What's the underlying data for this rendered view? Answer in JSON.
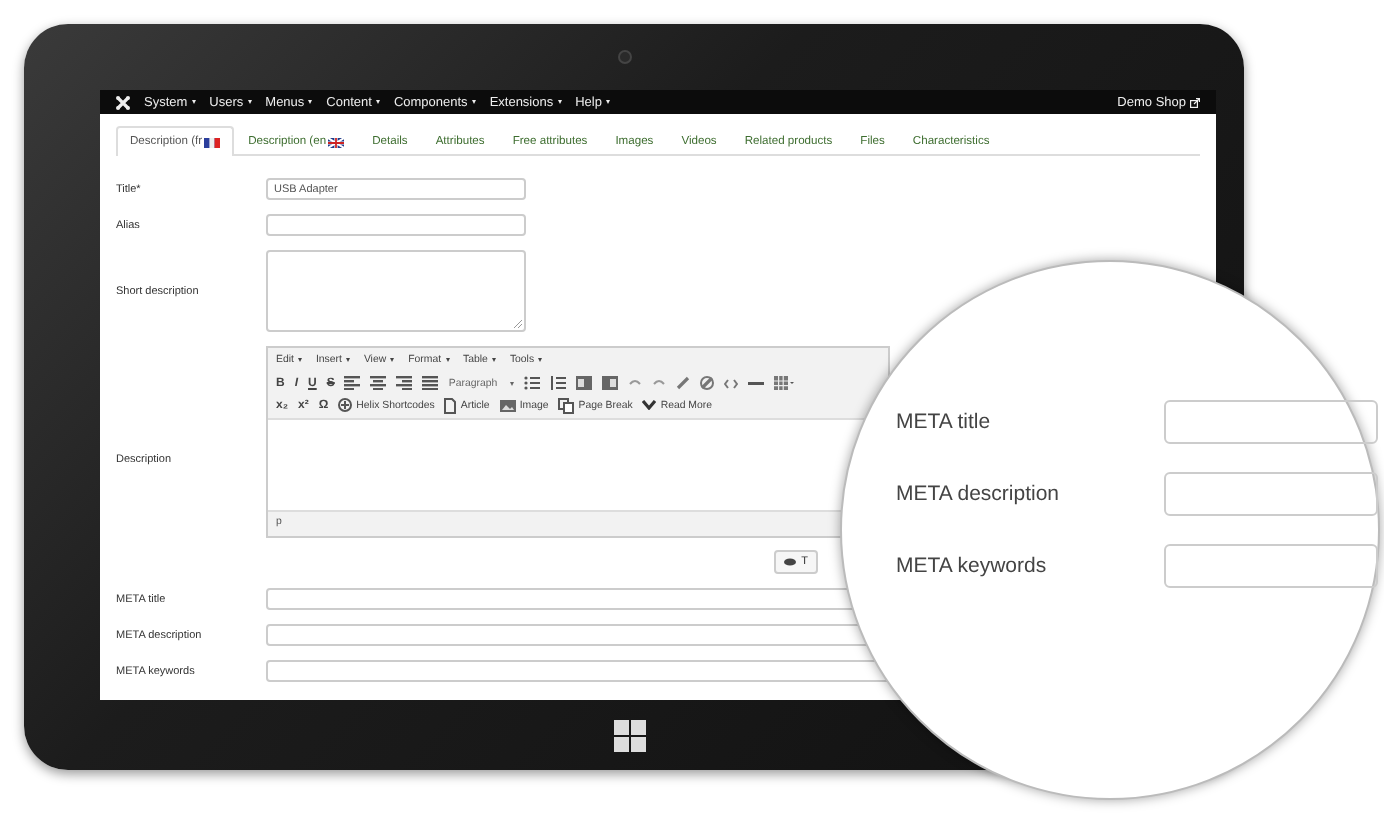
{
  "nav": {
    "menus": [
      {
        "label": "System"
      },
      {
        "label": "Users"
      },
      {
        "label": "Menus"
      },
      {
        "label": "Content"
      },
      {
        "label": "Components"
      },
      {
        "label": "Extensions"
      },
      {
        "label": "Help"
      }
    ],
    "site_link": "Demo Shop"
  },
  "tabs": [
    {
      "label": "Description (fr",
      "kind": "language",
      "selected": true
    },
    {
      "label": "Description (en",
      "kind": "language",
      "selected": false
    },
    {
      "label": "Details",
      "kind": "plain",
      "selected": false
    },
    {
      "label": "Attributes",
      "kind": "plain",
      "selected": false
    },
    {
      "label": "Free attributes",
      "kind": "plain",
      "selected": false
    },
    {
      "label": "Images",
      "kind": "plain",
      "selected": false
    },
    {
      "label": "Videos",
      "kind": "plain",
      "selected": false
    },
    {
      "label": "Related products",
      "kind": "plain",
      "selected": false
    },
    {
      "label": "Files",
      "kind": "plain",
      "selected": false
    },
    {
      "label": "Characteristics",
      "kind": "plain",
      "selected": false
    }
  ],
  "fields": [
    {
      "label": "Title*",
      "kind": "input",
      "value": "USB Adapter"
    },
    {
      "label": "Alias",
      "kind": "input"
    },
    {
      "label": "Short description",
      "kind": "textarea"
    },
    {
      "label": "Description",
      "kind": "editor"
    },
    {
      "label": "META title",
      "kind": "wide"
    },
    {
      "label": "META description",
      "kind": "wide"
    },
    {
      "label": "META keywords",
      "kind": "wide"
    }
  ],
  "editor": {
    "menus": [
      "Edit",
      "Insert",
      "View",
      "Format",
      "Table",
      "Tools"
    ],
    "format_glyphs": [
      "B",
      "I",
      "U",
      "S"
    ],
    "block_format": "Paragraph",
    "script_glyphs": [
      "x₂",
      "x²",
      "Ω"
    ],
    "buttons": [
      "Helix Shortcodes",
      "Article",
      "Image",
      "Page Break",
      "Read More"
    ],
    "status_path": "p",
    "toggle_button": "T"
  },
  "magnifier": {
    "fields": [
      {
        "label": "META title"
      },
      {
        "label": "META description"
      },
      {
        "label": "META keywords"
      }
    ]
  }
}
